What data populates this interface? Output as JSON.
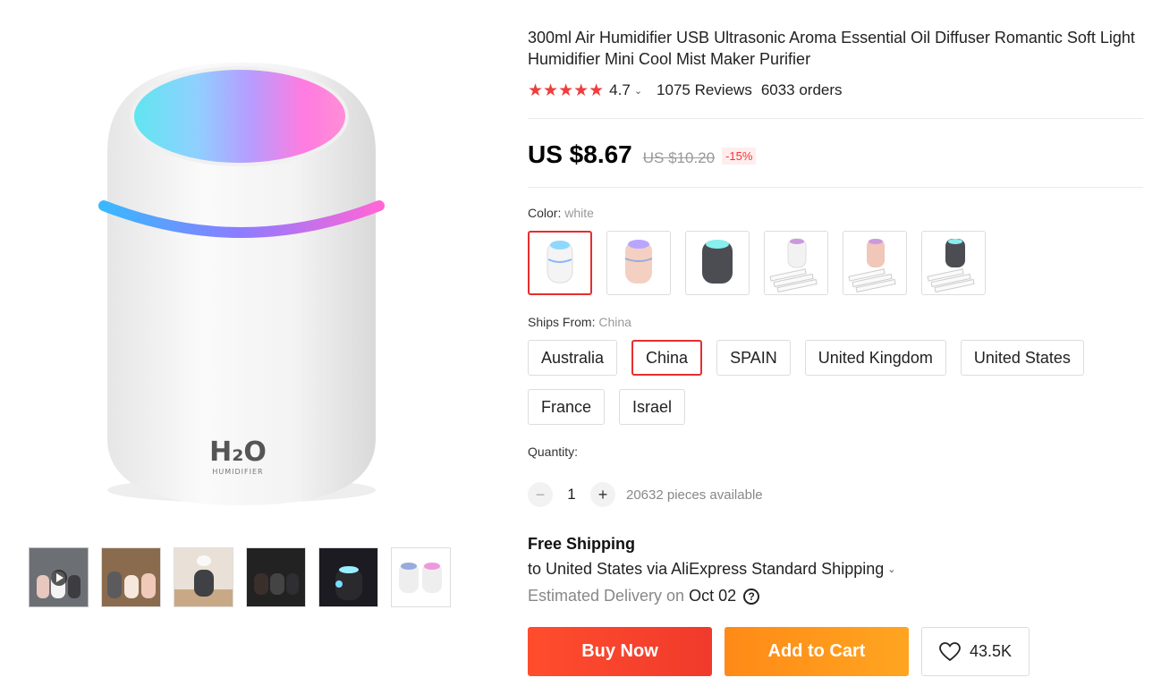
{
  "product": {
    "title": "300ml Air Humidifier USB Ultrasonic Aroma Essential Oil Diffuser Romantic Soft Light Humidifier Mini Cool Mist Maker Purifier",
    "image_text": "H₂O",
    "image_subtext": "HUMIDIFIER"
  },
  "rating": {
    "stars": "★★★★★",
    "value": "4.7",
    "chevron": "⌄",
    "reviews": "1075 Reviews",
    "orders": "6033 orders",
    "star_color": "#ee3e3e"
  },
  "price": {
    "current": "US $8.67",
    "original": "US $10.20",
    "discount": "-15%"
  },
  "color": {
    "label": "Color:",
    "selected": "white",
    "options": [
      "white",
      "pink",
      "dark gray",
      "white with filters",
      "pink with filters",
      "dark gray with filters"
    ]
  },
  "ships_from": {
    "label": "Ships From:",
    "selected": "China",
    "options": [
      "Australia",
      "China",
      "SPAIN",
      "United Kingdom",
      "United States",
      "France",
      "Israel"
    ]
  },
  "quantity": {
    "label": "Quantity:",
    "minus": "−",
    "value": "1",
    "plus": "+",
    "available": "20632 pieces available"
  },
  "shipping": {
    "title": "Free Shipping",
    "line": "to United States via AliExpress Standard Shipping",
    "chevron": "⌄",
    "delivery_label": "Estimated Delivery on",
    "delivery_date": "Oct 02",
    "help": "?"
  },
  "actions": {
    "buy_now": "Buy Now",
    "add_to_cart": "Add to Cart",
    "wishlist_count": "43.5K",
    "wishlist_icon": "heart-icon"
  },
  "colors": {
    "accent_red": "#e62e2e",
    "buy_gradient": "#ff4d2d",
    "cart_gradient": "#ff8a17"
  }
}
